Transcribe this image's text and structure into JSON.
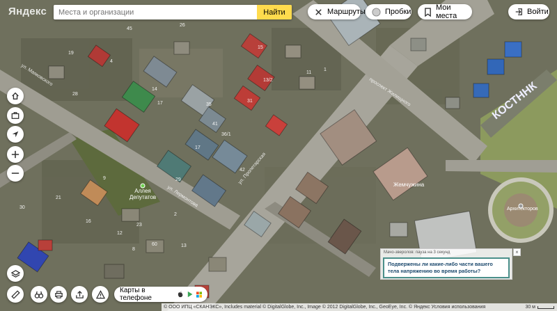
{
  "brand": "Яндекс",
  "search": {
    "placeholder": "Места и организации",
    "value": "Места и организации",
    "submit_label": "Найти"
  },
  "header": {
    "routes_label": "Маршруты",
    "traffic_label": "Пробки",
    "places_label": "Мои места",
    "login_label": "Войти"
  },
  "left_controls": [
    "home-icon",
    "briefcase-icon",
    "locate-icon",
    "zoom-in-icon",
    "zoom-out-icon"
  ],
  "bottom_controls": [
    "layers-icon",
    "ruler-icon",
    "binoculars-icon",
    "print-icon",
    "share-icon",
    "alert-icon"
  ],
  "phone_promo": {
    "label": "Карты в телефоне"
  },
  "map_labels": {
    "alley": "Аллея",
    "alley2": "Депутатов",
    "plaza": "Архитекторов",
    "grand": "Жемчужина",
    "kost": "КОСТННК",
    "st1": "ул. Маяковского",
    "st2": "ул. Пролетарская",
    "st3": "проспект Жилищного",
    "st4": "ул. Лермонтова"
  },
  "house_numbers": [
    "45",
    "26",
    "19",
    "4",
    "15",
    "28",
    "11",
    "1",
    "13/2",
    "14",
    "17",
    "35",
    "31",
    "36/1",
    "41",
    "17",
    "42",
    "29",
    "2",
    "30",
    "21",
    "9",
    "16",
    "23",
    "60",
    "12",
    "8",
    "13",
    "1"
  ],
  "ad": {
    "header": "Мачо-зверолов: пауза на 3 секунд",
    "text": "Подвержены ли какие-либо части вашего тела напряжению во время работы?",
    "close": "×"
  },
  "footer": {
    "copyright": "© ООО ИПЦ «СКАНЭКС», Includes material © DigitalGlobe, Inc., Image © 2012 DigitalGlobe, Inc., GeoEye, Inc. © Яндекс Условия использования",
    "scale": "30 м"
  },
  "colors": {
    "accent": "#ffdb4d",
    "ad_border": "#4a8f8a"
  }
}
